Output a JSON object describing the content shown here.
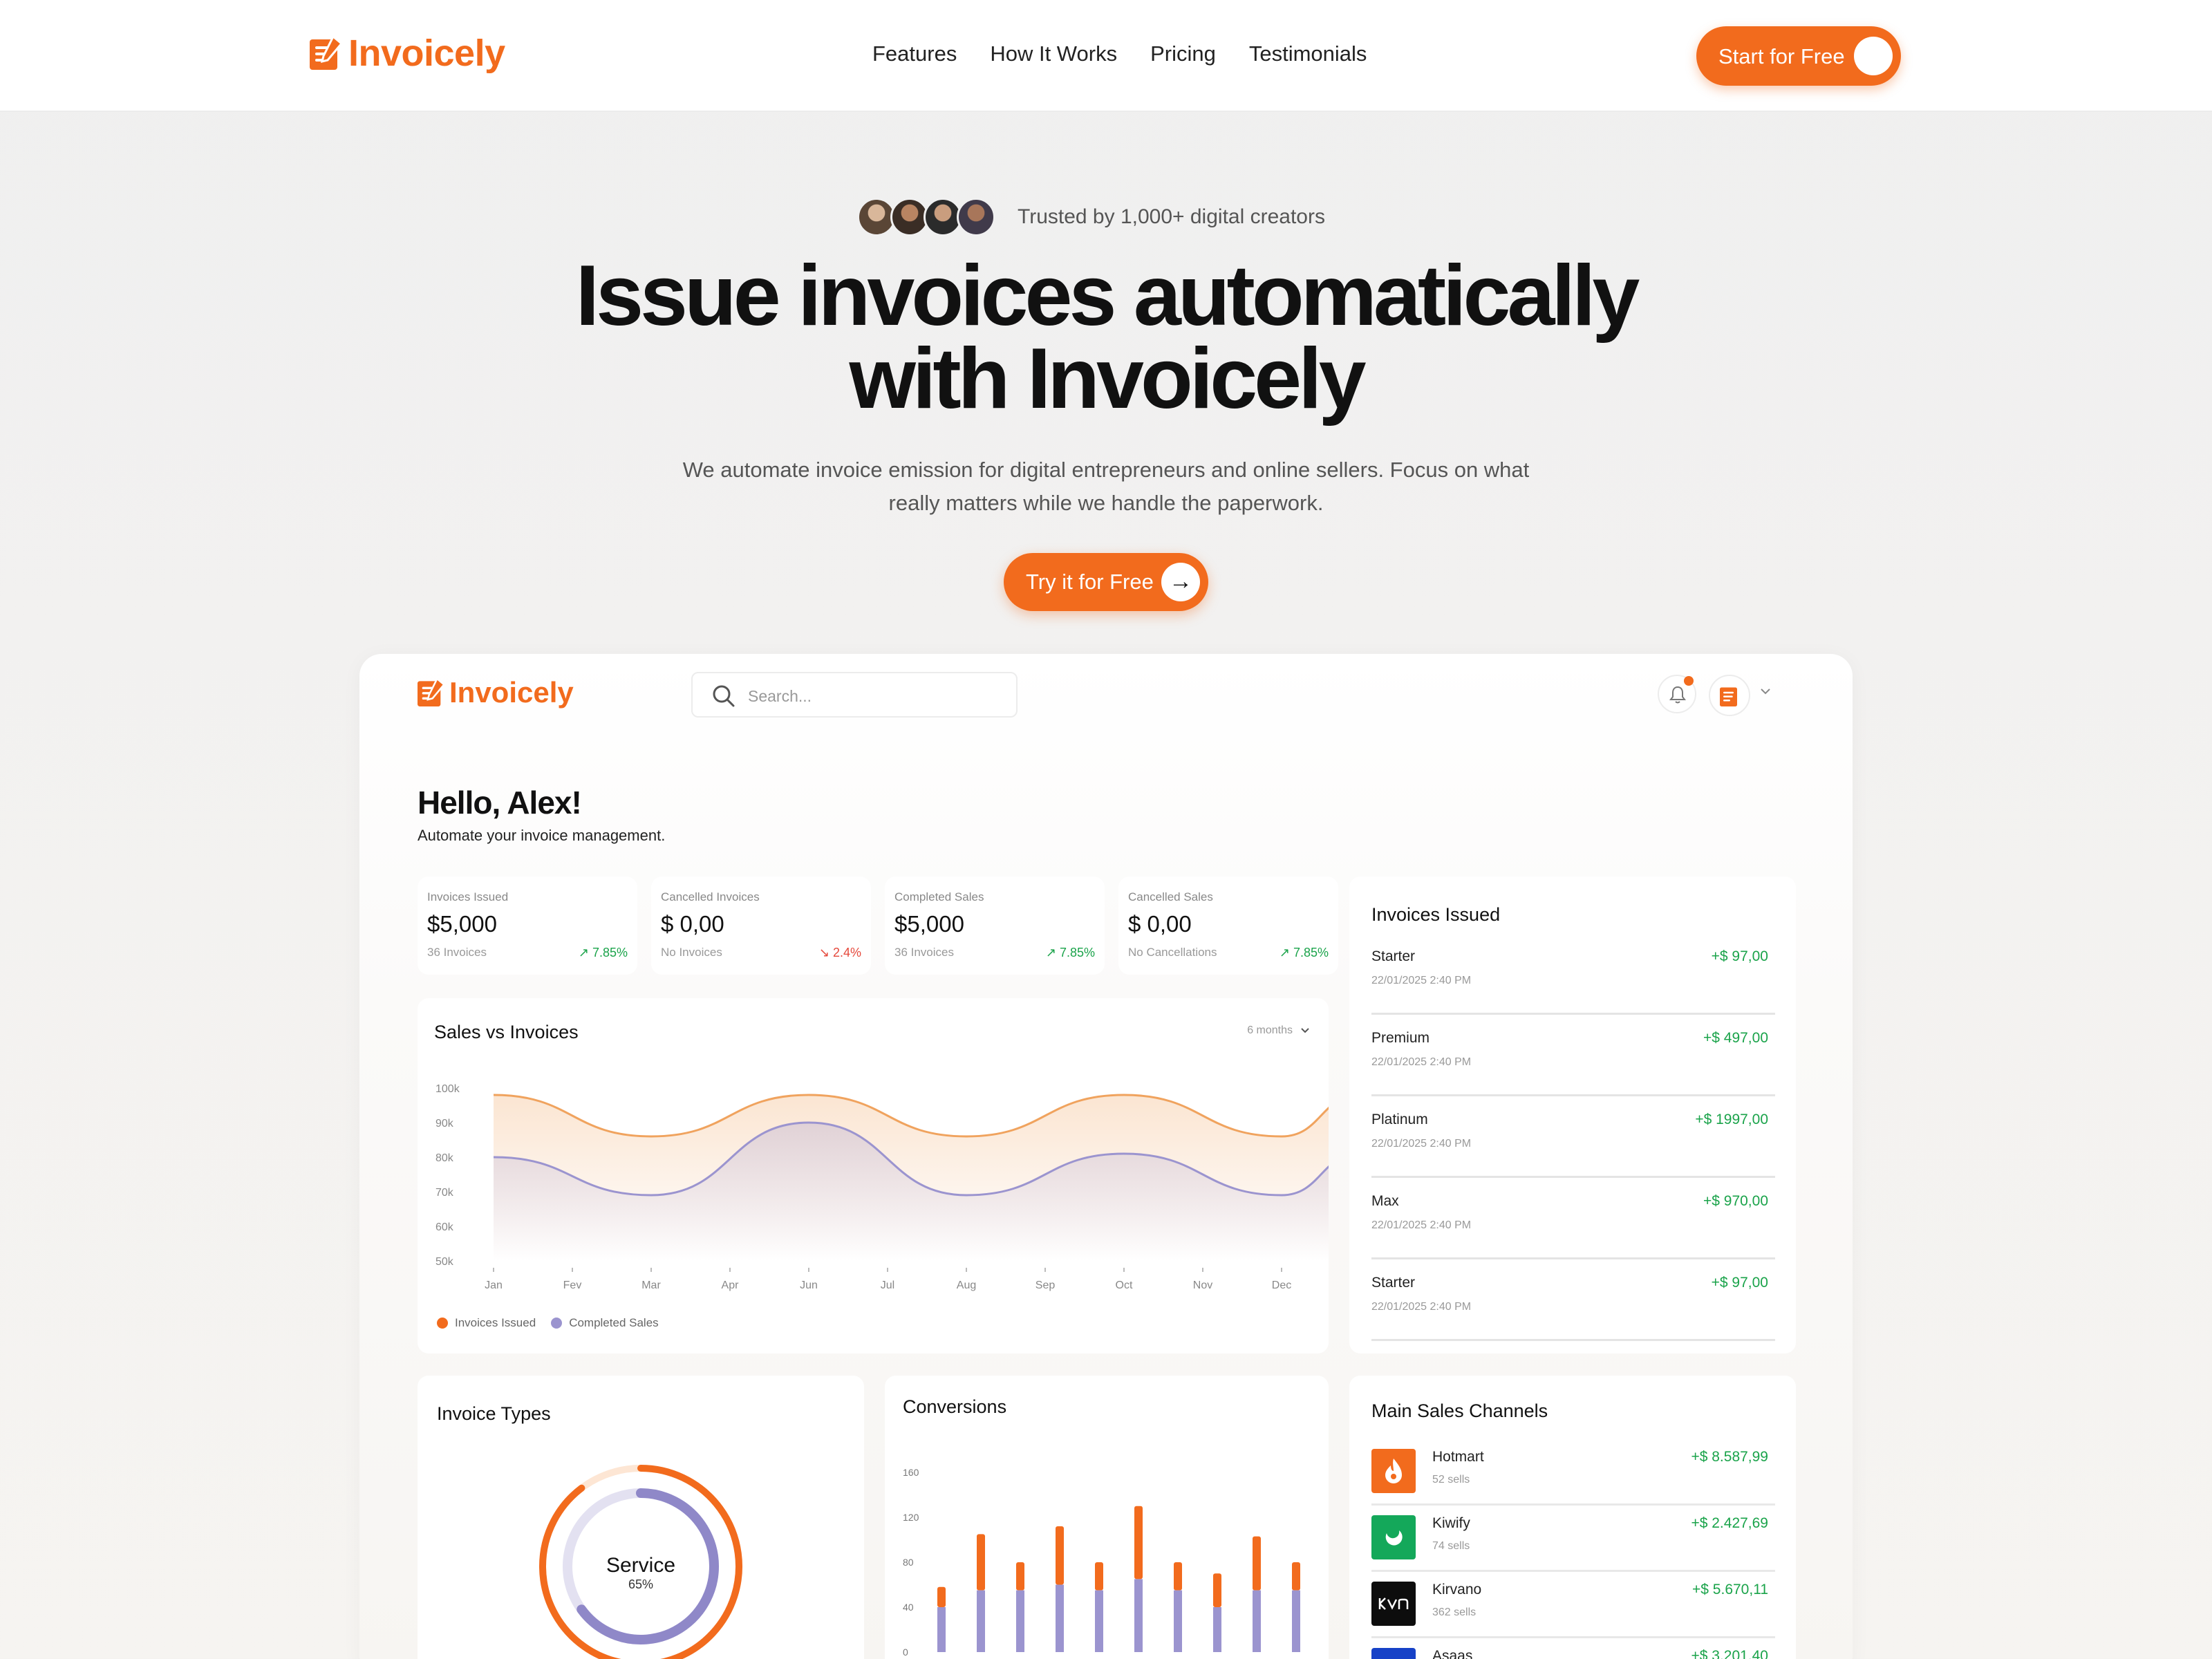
{
  "brand": {
    "name": "Invoicely",
    "accent": "#f26b1d"
  },
  "nav": {
    "links": [
      "Features",
      "How It Works",
      "Pricing",
      "Testimonials"
    ],
    "cta": "Start for Free"
  },
  "hero": {
    "trusted": "Trusted by 1,000+ digital creators",
    "title_line1": "Issue invoices automatically",
    "title_line2": "with Invoicely",
    "subtitle": "We automate invoice emission for digital entrepreneurs and online sellers. Focus on what really matters while we handle the paperwork.",
    "cta": "Try it for Free",
    "cta_icon": "arrow-right-icon"
  },
  "dashboard": {
    "search_placeholder": "Search...",
    "greeting": "Hello, Alex!",
    "greeting_sub": "Automate your invoice management.",
    "stats": [
      {
        "title": "Invoices Issued",
        "value": "$5,000",
        "sub": "36 Invoices",
        "change": "7.85%",
        "trend": "up"
      },
      {
        "title": "Cancelled Invoices",
        "value": "$ 0,00",
        "sub": "No Invoices",
        "change": "2.4%",
        "trend": "down"
      },
      {
        "title": "Completed Sales",
        "value": "$5,000",
        "sub": "36 Invoices",
        "change": "7.85%",
        "trend": "up"
      },
      {
        "title": "Cancelled Sales",
        "value": "$ 0,00",
        "sub": "No Cancellations",
        "change": "7.85%",
        "trend": "up"
      }
    ],
    "sales_chart": {
      "title": "Sales vs Invoices",
      "period": "6 months",
      "legend": [
        "Invoices Issued",
        "Completed Sales"
      ]
    },
    "invoices_list": {
      "title": "Invoices Issued",
      "items": [
        {
          "name": "Starter",
          "date": "22/01/2025 2:40 PM",
          "amount": "+$ 97,00"
        },
        {
          "name": "Premium",
          "date": "22/01/2025 2:40 PM",
          "amount": "+$ 497,00"
        },
        {
          "name": "Platinum",
          "date": "22/01/2025 2:40 PM",
          "amount": "+$ 1997,00"
        },
        {
          "name": "Max",
          "date": "22/01/2025 2:40 PM",
          "amount": "+$ 970,00"
        },
        {
          "name": "Starter",
          "date": "22/01/2025 2:40 PM",
          "amount": "+$ 97,00"
        }
      ]
    },
    "invoice_types": {
      "title": "Invoice Types",
      "center_label": "Service",
      "center_value": "65%"
    },
    "conversions": {
      "title": "Conversions"
    },
    "channels": {
      "title": "Main Sales Channels",
      "items": [
        {
          "name": "Hotmart",
          "sub": "52 sells",
          "amount": "+$ 8.587,99",
          "icon": "hotmart-icon",
          "color": "#f26b1d"
        },
        {
          "name": "Kiwify",
          "sub": "74 sells",
          "amount": "+$ 2.427,69",
          "icon": "kiwify-icon",
          "color": "#14a85a"
        },
        {
          "name": "Kirvano",
          "sub": "362 sells",
          "amount": "+$ 5.670,11",
          "icon": "kirvano-icon",
          "color": "#0d0d0d"
        },
        {
          "name": "Asaas",
          "sub": "",
          "amount": "+$ 3.201,40",
          "icon": "asaas-icon",
          "color": "#1742c7"
        }
      ]
    }
  },
  "chart_data": [
    {
      "type": "area",
      "title": "Sales vs Invoices",
      "x": [
        "Jan",
        "Fev",
        "Mar",
        "Apr",
        "Jun",
        "Jul",
        "Aug",
        "Sep",
        "Oct",
        "Nov",
        "Dec"
      ],
      "y_ticks": [
        "100k",
        "90k",
        "80k",
        "70k",
        "60k",
        "50k"
      ],
      "ylim": [
        50000,
        100000
      ],
      "series": [
        {
          "name": "Invoices Issued",
          "color": "#f0a35e",
          "points": [
            [
              0,
              98000
            ],
            [
              2,
              86000
            ],
            [
              4,
              98000
            ],
            [
              6,
              86000
            ],
            [
              8,
              98000
            ],
            [
              10,
              86000
            ],
            [
              11,
              98000
            ]
          ]
        },
        {
          "name": "Completed Sales",
          "color": "#9b94cf",
          "points": [
            [
              0,
              80000
            ],
            [
              2,
              69000
            ],
            [
              4,
              90000
            ],
            [
              6,
              69000
            ],
            [
              8,
              81000
            ],
            [
              10,
              69000
            ],
            [
              11,
              81000
            ]
          ]
        }
      ]
    },
    {
      "type": "bar",
      "title": "Conversions",
      "y_ticks": [
        160,
        120,
        80,
        40,
        0
      ],
      "ylim": [
        0,
        160
      ],
      "series": [
        {
          "name": "",
          "color": "#f26b1d",
          "values": [
            58,
            105,
            80,
            112,
            80,
            130,
            80,
            70,
            103,
            80
          ]
        },
        {
          "name": "",
          "color": "#9b94cf",
          "values": [
            40,
            55,
            55,
            60,
            55,
            65,
            55,
            40,
            55,
            55
          ]
        }
      ]
    },
    {
      "type": "pie",
      "title": "Invoice Types",
      "slices": [
        {
          "label": "Service",
          "value": 65
        }
      ]
    }
  ]
}
